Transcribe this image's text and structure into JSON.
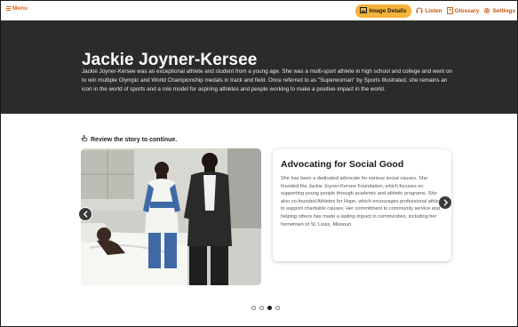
{
  "topbar": {
    "menu_label": "Menu",
    "tools": [
      {
        "label": "Image Details",
        "icon": "image-icon",
        "active": true
      },
      {
        "label": "Listen",
        "icon": "headphones-icon",
        "active": false
      },
      {
        "label": "Glossary",
        "icon": "book-icon",
        "active": false
      },
      {
        "label": "Settings",
        "icon": "gear-icon",
        "active": false
      }
    ]
  },
  "hero": {
    "title": "Jackie Joyner-Kersee",
    "description": "Jackie Joyner-Kersee was an exceptional athlete and student from a young age. She was a multi-sport athlete in high school and college and went on to win multiple Olympic and World Championship medals in track and field. Once referred to as \"Superwoman\" by Sports Illustrated, she remains an icon in the world of sports and a role model for aspiring athletes and people working to make a positive impact in the world."
  },
  "story": {
    "prompt": "Review the story to continue.",
    "card_title": "Advocating for Social Good",
    "card_text": "She has been a dedicated advocate for various social causes. She founded the Jackie Joyner-Kersee Foundation, which focuses on supporting young people through academic and athletic programs. She also co-founded Athletes for Hope, which encourages professional athletes to support charitable causes. Her commitment to community service and helping others has made a lasting impact in communities, including her hometown of St. Louis, Missouri.",
    "slide_count": 4,
    "active_slide": 3
  },
  "colors": {
    "accent": "#d0661a",
    "active_tool_bg": "#f5b43a",
    "hero_bg": "#2b2b2b"
  }
}
